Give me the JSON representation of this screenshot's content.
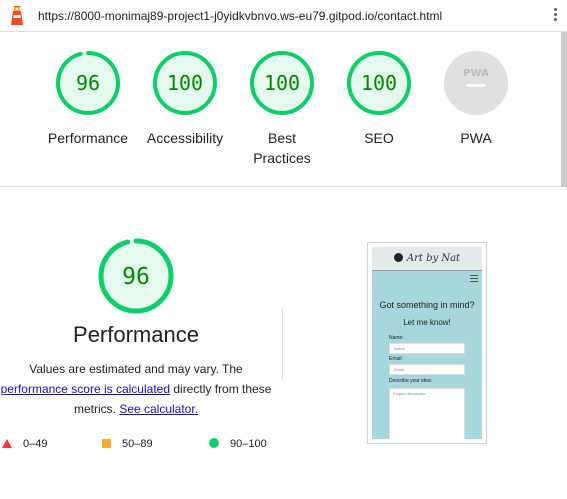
{
  "browser": {
    "url": "https://8000-monimaj89-project1-j0yidkvbnvo.ws-eu79.gitpod.io/contact.html",
    "logo_icon": "lighthouse-icon",
    "menu_icon": "kebab-menu-icon"
  },
  "colors": {
    "pass": "#0cce6b",
    "pass_text": "#008800",
    "pass_fill": "#e5f9ee",
    "fail": "#ff3333",
    "average": "#ffaa33",
    "na": "#e0e0e0"
  },
  "gauges": [
    {
      "score": "96",
      "value": 96,
      "label": "Performance"
    },
    {
      "score": "100",
      "value": 100,
      "label": "Accessibility"
    },
    {
      "score": "100",
      "value": 100,
      "label": "Best Practices"
    },
    {
      "score": "100",
      "value": 100,
      "label": "SEO"
    },
    {
      "score": "",
      "value": null,
      "label": "PWA",
      "badge": "PWA"
    }
  ],
  "performance": {
    "score": "96",
    "value": 96,
    "title": "Performance",
    "desc_before": "Values are estimated and may vary. The ",
    "score_link": "performance score is calculated",
    "desc_mid": " directly from these metrics. ",
    "calc_link": "See calculator."
  },
  "legend": [
    {
      "range": "0–49",
      "shape": "triangle",
      "color": "#ff3333"
    },
    {
      "range": "50–89",
      "shape": "square",
      "color": "#ffaa33"
    },
    {
      "range": "90–100",
      "shape": "circle",
      "color": "#0cce6b"
    }
  ],
  "screenshot": {
    "brand": "Art by Nat",
    "heading": "Got something in mind?",
    "subheading": "Let me know!",
    "name_label": "Name:",
    "name_placeholder": "Name",
    "email_label": "Email:",
    "email_placeholder": "Email",
    "idea_label": "Describe your idea:",
    "idea_placeholder": "Project description"
  }
}
